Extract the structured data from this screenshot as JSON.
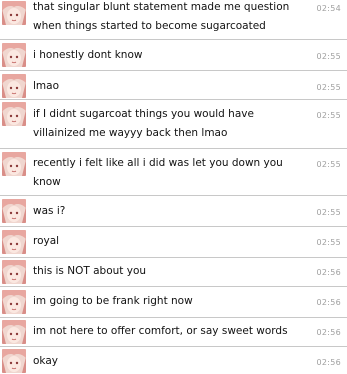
{
  "messages": [
    {
      "text": "that singular blunt statement made me question when things started to become sugarcoated",
      "time": "02:54"
    },
    {
      "text": "i honestly dont know",
      "time": "02:55"
    },
    {
      "text": "lmao",
      "time": "02:55"
    },
    {
      "text": "if I didnt sugarcoat things you would have villainized me wayyy back then lmao",
      "time": "02:55"
    },
    {
      "text": "recently i felt like all i did was let you down you know",
      "time": "02:55"
    },
    {
      "text": "was i?",
      "time": "02:55"
    },
    {
      "text": "royal",
      "time": "02:55"
    },
    {
      "text": "this is NOT about you",
      "time": "02:56"
    },
    {
      "text": "im going to be frank right now",
      "time": "02:56"
    },
    {
      "text": "im not here to offer comfort, or say sweet words",
      "time": "02:56"
    },
    {
      "text": "okay",
      "time": "02:56"
    }
  ],
  "avatar_icon": "user-avatar-icon",
  "colors": {
    "divider": "#c8c8c8",
    "timestamp": "#a0a0a0",
    "text": "#111111",
    "avatar_hair": "#e8a7a0"
  }
}
